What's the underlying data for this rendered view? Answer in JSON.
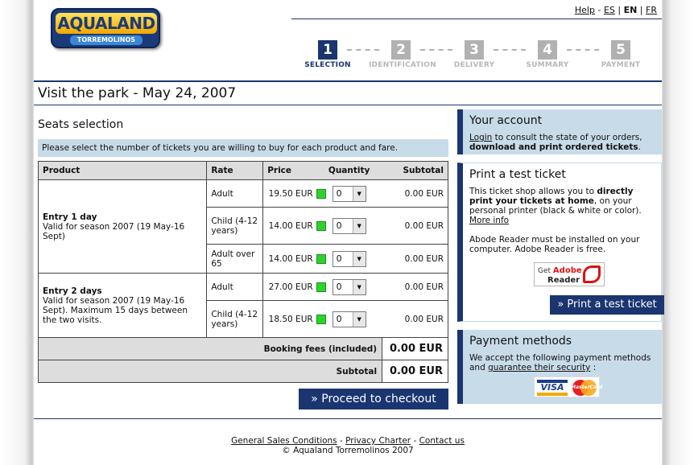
{
  "brand": {
    "name": "AQUALAND",
    "sub": "TORREMOLINOS"
  },
  "toplinks": {
    "help": "Help",
    "sep1": " - ",
    "es": "ES",
    "sep2": " | ",
    "en": "EN",
    "sep3": " | ",
    "fr": "FR"
  },
  "steps": [
    {
      "num": "1",
      "label": "SELECTION",
      "active": true
    },
    {
      "num": "2",
      "label": "IDENTIFICATION",
      "active": false
    },
    {
      "num": "3",
      "label": "DELIVERY",
      "active": false
    },
    {
      "num": "4",
      "label": "SUMMARY",
      "active": false
    },
    {
      "num": "5",
      "label": "PAYMENT",
      "active": false
    }
  ],
  "page_title": "Visit the park - May 24, 2007",
  "seats": {
    "title": "Seats selection",
    "notice": "Please select the number of tickets you are willing to buy for each product and fare.",
    "headers": {
      "product": "Product",
      "rate": "Rate",
      "price": "Price",
      "quantity": "Quantity",
      "subtotal": "Subtotal"
    },
    "products": [
      {
        "name": "Entry 1 day",
        "desc": "Valid for season 2007 (19 May-16 Sept)"
      },
      {
        "name": "Entry 2 days",
        "desc": "Valid for season 2007 (19 May-16 Sept). Maximum 15 days between the two visits."
      }
    ],
    "rows": [
      {
        "rate": "Adult",
        "price": "19.50 EUR",
        "qty": "0",
        "subtotal": "0.00 EUR"
      },
      {
        "rate": "Child (4-12 years)",
        "price": "14.00 EUR",
        "qty": "0",
        "subtotal": "0.00 EUR"
      },
      {
        "rate": "Adult over 65",
        "price": "14.00 EUR",
        "qty": "0",
        "subtotal": "0.00 EUR"
      },
      {
        "rate": "Adult",
        "price": "27.00 EUR",
        "qty": "0",
        "subtotal": "0.00 EUR"
      },
      {
        "rate": "Child (4-12 years)",
        "price": "18.50 EUR",
        "qty": "0",
        "subtotal": "0.00 EUR"
      }
    ],
    "booking_fees_label": "Booking fees (included)",
    "booking_fees_value": "0.00 EUR",
    "subtotal_label": "Subtotal",
    "subtotal_value": "0.00 EUR",
    "checkout": "» Proceed to checkout"
  },
  "account": {
    "title": "Your account",
    "login": "Login",
    "text1": " to consult the state of your orders, ",
    "bold": "download and print ordered tickets",
    "text2": "."
  },
  "test_ticket": {
    "title": "Print a test ticket",
    "t1": "This ticket shop allows you to ",
    "b1": "directly print your tickets at home",
    "t2": ", on your personal printer (black & white or color). ",
    "more": "More info",
    "reader_note": "Abode Reader must be installed on your computer. Adobe Reader is free.",
    "adobe_get": "Get",
    "adobe_brand": "Adobe",
    "adobe_reader": "Reader",
    "button": "» Print a test ticket"
  },
  "payment": {
    "title": "Payment methods",
    "t1": "We accept the following payment methods and ",
    "link": "guarantee their security",
    "t2": " :",
    "visa": "VISA",
    "mastercard": "MasterCard"
  },
  "footer": {
    "gsc": "General Sales Conditions",
    "privacy": "Privacy Charter",
    "contact": "Contact us",
    "sep": " - ",
    "copyright": "© Aqualand Torremolinos 2007"
  },
  "colors": {
    "navy": "#1a3570",
    "light_blue": "#c8dbe9",
    "stock_green": "#2fd12f",
    "step_inactive": "#b1b1b1"
  }
}
